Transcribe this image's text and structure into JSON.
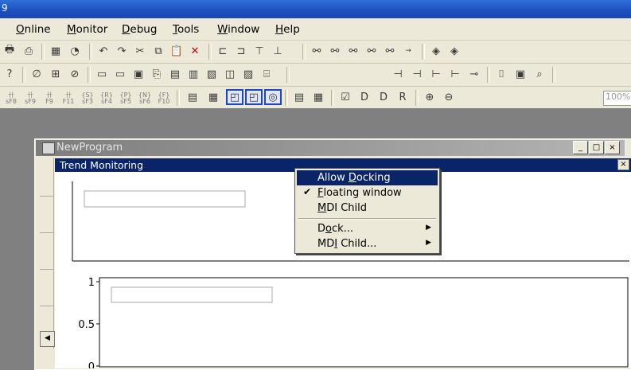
{
  "titlebar": {
    "text": "9"
  },
  "menu": [
    {
      "pre": "",
      "u": "O",
      "post": "nline"
    },
    {
      "pre": "",
      "u": "M",
      "post": "onitor"
    },
    {
      "pre": "",
      "u": "D",
      "post": "ebug"
    },
    {
      "pre": "",
      "u": "T",
      "post": "ools"
    },
    {
      "pre": "",
      "u": "W",
      "post": "indow"
    },
    {
      "pre": "",
      "u": "H",
      "post": "elp"
    }
  ],
  "toolbar3": {
    "fkeys": [
      "sF8",
      "sF9",
      "F9",
      "F11",
      "sF3",
      "sF4",
      "sF5",
      "sF6",
      "F10"
    ],
    "zoom": "100%"
  },
  "mdi_window": {
    "title": "NewProgram",
    "buttons": [
      "_",
      "□",
      "×"
    ]
  },
  "trend_window": {
    "title": "Trend Monitoring",
    "close": "×"
  },
  "chart_data": {
    "type": "line",
    "yticks": [
      "1",
      "0.5",
      "0"
    ],
    "ylim": [
      0,
      1
    ],
    "series": []
  },
  "context_menu": {
    "items": [
      {
        "pre": "Allow ",
        "u": "D",
        "post": "ocking",
        "checked": false,
        "submenu": false,
        "highlighted": true
      },
      {
        "pre": "",
        "u": "F",
        "post": "loating window",
        "checked": true,
        "submenu": false,
        "highlighted": false
      },
      {
        "pre": "",
        "u": "M",
        "post": "DI Child",
        "checked": false,
        "submenu": false,
        "highlighted": false
      },
      {
        "pre": "D",
        "u": "o",
        "post": "ck...",
        "checked": false,
        "submenu": true,
        "highlighted": false
      },
      {
        "pre": "MD",
        "u": "I",
        "post": " Child...",
        "checked": false,
        "submenu": true,
        "highlighted": false
      }
    ],
    "check_glyph": "✔",
    "submenu_glyph": "▶"
  }
}
